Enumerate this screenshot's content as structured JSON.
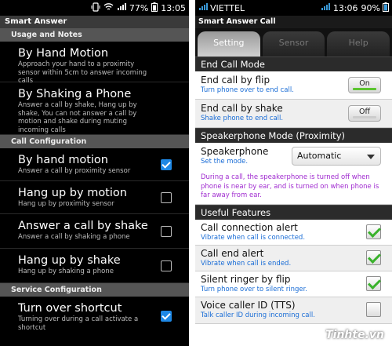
{
  "left": {
    "status": {
      "battery": "77%",
      "time": "13:05"
    },
    "title": "Smart Answer",
    "sections": {
      "usage": "Usage and Notes",
      "call_config": "Call Configuration",
      "service": "Service Configuration"
    },
    "usage_items": [
      {
        "title": "By Hand Motion",
        "summary": "Approach your hand to a proximity sensor within 5cm to answer incoming calls"
      },
      {
        "title": "By Shaking a Phone",
        "summary": "Answer a call by shake, Hang up by shake, You can not answer a call by motion and shake during muting incoming calls"
      }
    ],
    "call_items": [
      {
        "title": "By hand motion",
        "summary": "Answer a call by proximity sensor",
        "checked": true
      },
      {
        "title": "Hang up by motion",
        "summary": "Hang up by proximity sensor",
        "checked": false
      },
      {
        "title": "Answer a call by shake",
        "summary": "Answer a call by shaking a phone",
        "checked": false
      },
      {
        "title": "Hang up by shake",
        "summary": "Hang up by shaking a phone",
        "checked": false
      }
    ],
    "service_items": [
      {
        "title": "Turn over shortcut",
        "summary": "Turning over during a call activate a shortcut",
        "checked": true
      }
    ]
  },
  "right": {
    "status": {
      "carrier": "VIETTEL",
      "time": "13:06",
      "battery": "90%"
    },
    "title": "Smart Answer Call",
    "tabs": [
      "Setting",
      "Sensor",
      "Help"
    ],
    "sections": {
      "end_call": "End Call Mode",
      "speaker": "Speakerphone Mode (Proximity)",
      "useful": "Useful Features"
    },
    "end_call_items": [
      {
        "title": "End call by flip",
        "summary": "Turn phone over to end call.",
        "toggle": "On",
        "on": true
      },
      {
        "title": "End call by shake",
        "summary": "Shake phone to end call.",
        "toggle": "Off",
        "on": false
      }
    ],
    "speaker": {
      "title": "Speakerphone",
      "summary": "Set the mode.",
      "selected": "Automatic",
      "note": "During a call, the speakerphone is turned off when phone is near by ear, and is turned on when phone is far away from ear."
    },
    "useful_items": [
      {
        "title": "Call connection alert",
        "summary": "Vibrate when call is connected.",
        "checked": true
      },
      {
        "title": "Call end alert",
        "summary": "Vibrate when call is ended.",
        "checked": true
      },
      {
        "title": "Silent ringer by flip",
        "summary": "Turn phone over to silent ringer.",
        "checked": true
      },
      {
        "title": "Voice caller ID (TTS)",
        "summary": "Talk caller ID during incoming call.",
        "checked": false
      }
    ],
    "watermark": "Tinhte.vn",
    "colors": {
      "accent_check": "#3ab22c",
      "summary_blue": "#1a6dd6",
      "note_purple": "#a02bd0",
      "left_check_blue": "#1e88e5"
    }
  }
}
